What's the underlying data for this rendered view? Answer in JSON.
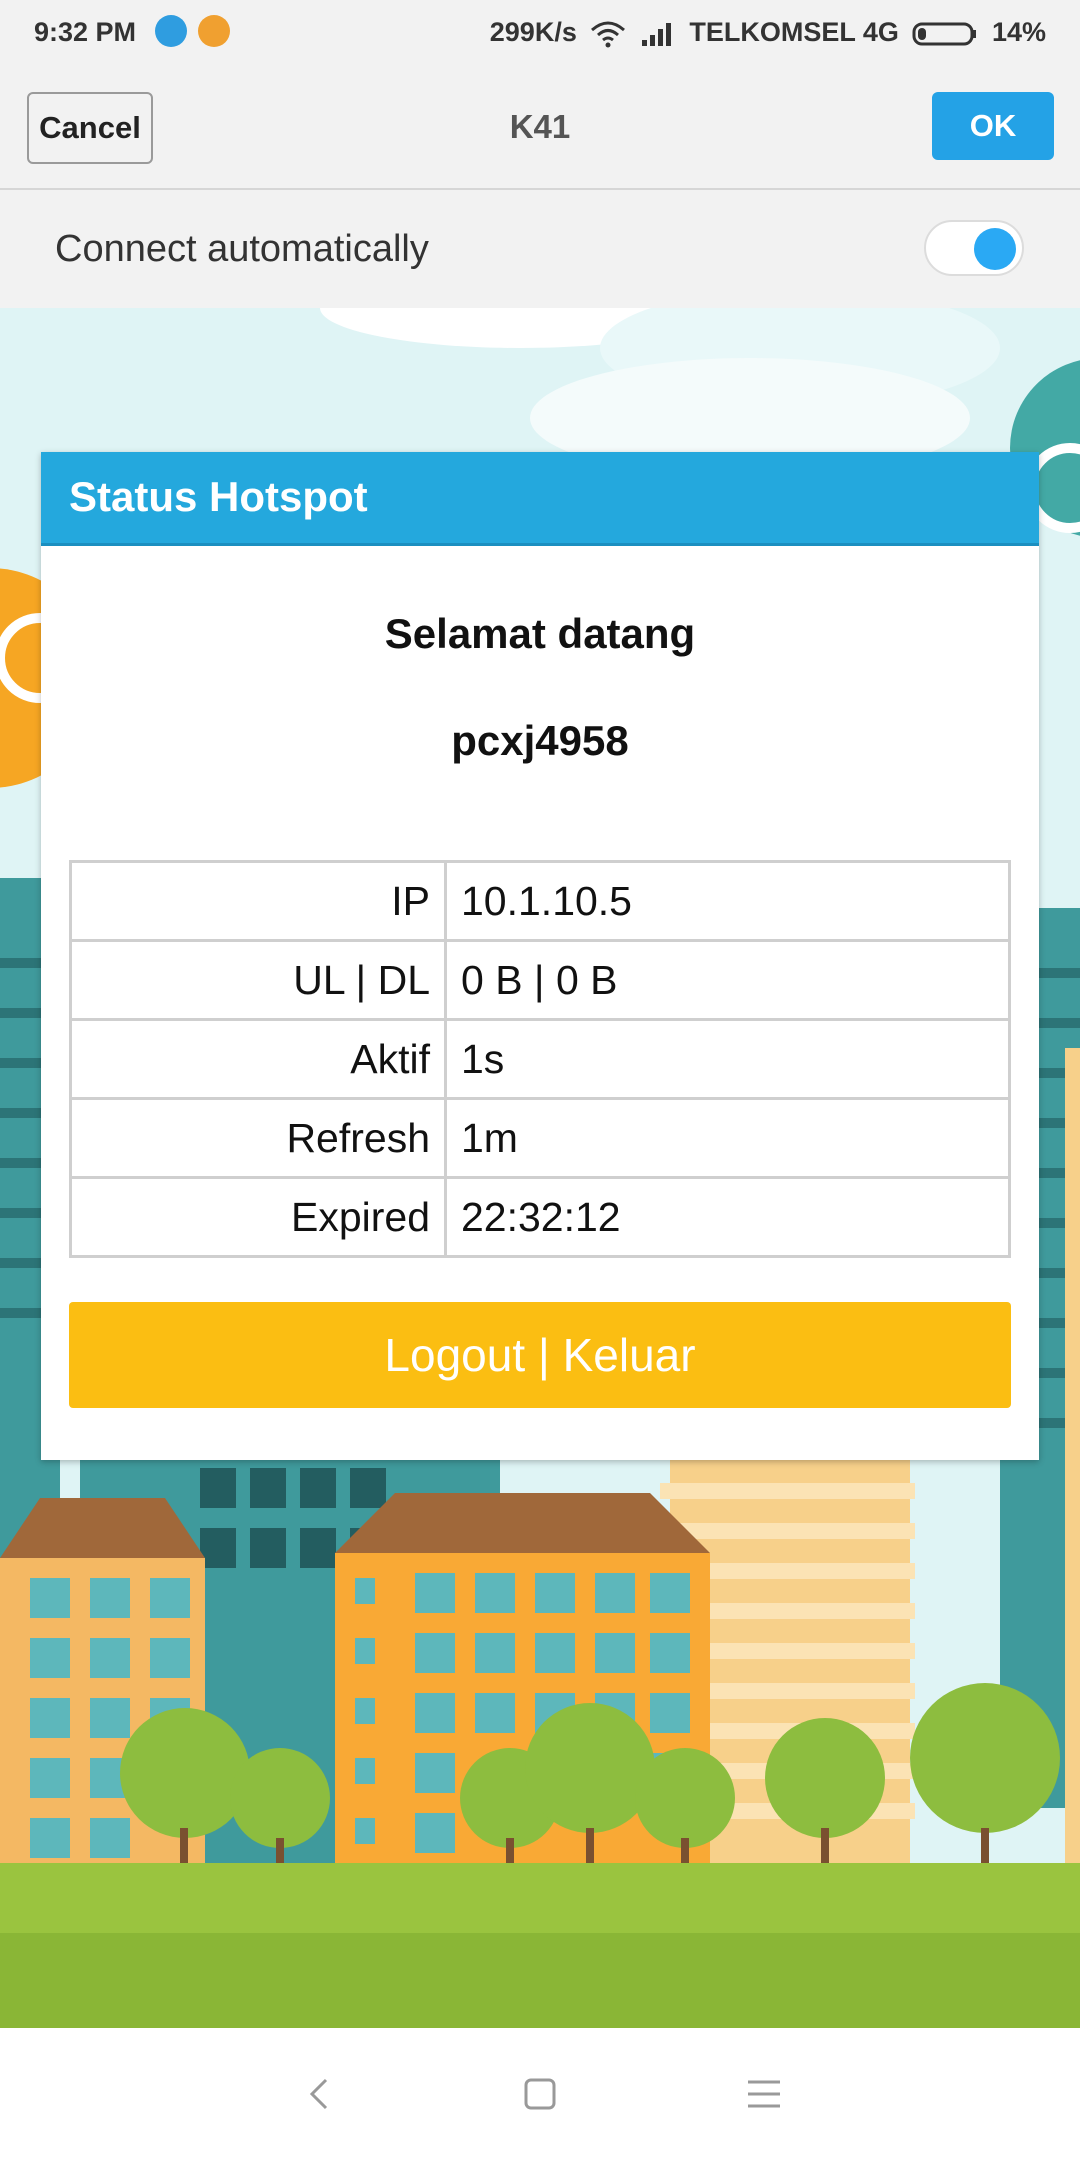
{
  "status_bar": {
    "time": "9:32 PM",
    "speed": "299K/s",
    "carrier": "TELKOMSEL 4G",
    "battery": "14%",
    "icons": [
      "wifi-app-icon",
      "app-icon",
      "wifi-icon",
      "signal-icon",
      "battery-icon"
    ]
  },
  "header": {
    "cancel_label": "Cancel",
    "title": "K41",
    "ok_label": "OK"
  },
  "connect": {
    "label": "Connect automatically",
    "enabled": true
  },
  "dialog": {
    "title": "Status Hotspot",
    "welcome": "Selamat datang",
    "username": "pcxj4958",
    "rows": [
      {
        "key": "IP",
        "value": "10.1.10.5"
      },
      {
        "key": "UL | DL",
        "value": "0 B | 0 B"
      },
      {
        "key": "Aktif",
        "value": "1s"
      },
      {
        "key": "Refresh",
        "value": "1m"
      },
      {
        "key": "Expired",
        "value": "22:32:12"
      }
    ],
    "logout_label": "Logout | Keluar"
  },
  "colors": {
    "accent": "#24a2e6",
    "dialog_header": "#24a8dd",
    "logout_button": "#fbbe12",
    "toggle_knob": "#2aa9f4"
  },
  "nav": {
    "icons": [
      "back-icon",
      "home-icon",
      "menu-icon"
    ]
  }
}
